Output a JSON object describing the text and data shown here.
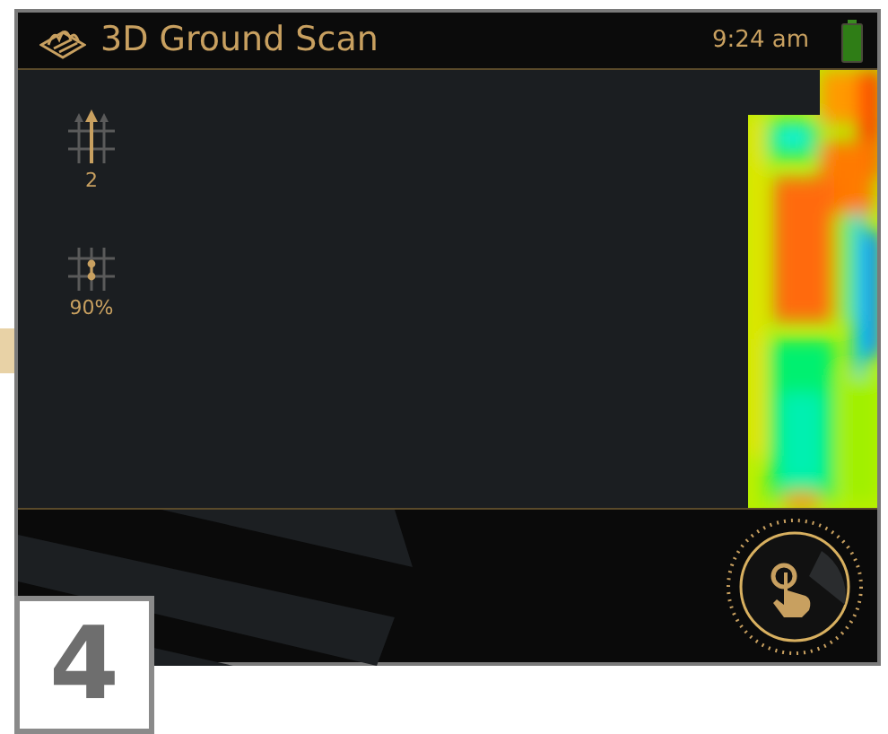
{
  "header": {
    "title": "3D Ground Scan",
    "time": "9:24 am"
  },
  "tools": [
    {
      "kind": "passes",
      "value": "2"
    },
    {
      "kind": "density",
      "value": "90%"
    }
  ],
  "step_number": "4"
}
